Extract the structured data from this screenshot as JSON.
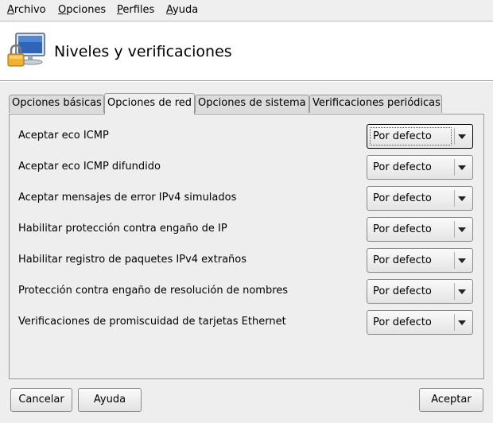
{
  "menubar": {
    "items": [
      {
        "accel": "A",
        "rest": "rchivo"
      },
      {
        "accel": "O",
        "rest": "pciones"
      },
      {
        "accel": "P",
        "rest": "erfiles"
      },
      {
        "accel": "A",
        "rest": "yuda"
      }
    ]
  },
  "header": {
    "title": "Niveles y verificaciones",
    "icon": "monitor-lock-icon"
  },
  "tabs": [
    {
      "label": "Opciones básicas",
      "active": false
    },
    {
      "label": "Opciones de red",
      "active": true
    },
    {
      "label": "Opciones de sistema",
      "active": false
    },
    {
      "label": "Verificaciones periódicas",
      "active": false
    }
  ],
  "options": [
    {
      "label": "Aceptar eco ICMP",
      "value": "Por defecto"
    },
    {
      "label": "Aceptar eco ICMP difundido",
      "value": "Por defecto"
    },
    {
      "label": "Aceptar mensajes de error IPv4 simulados",
      "value": "Por defecto"
    },
    {
      "label": "Habilitar protección contra engaño de IP",
      "value": "Por defecto"
    },
    {
      "label": "Habilitar registro de paquetes IPv4 extraños",
      "value": "Por defecto"
    },
    {
      "label": "Protección contra engaño de resolución de nombres",
      "value": "Por defecto"
    },
    {
      "label": "Verificaciones de promiscuidad de tarjetas Ethernet",
      "value": "Por defecto"
    }
  ],
  "buttons": {
    "cancel": "Cancelar",
    "help": "Ayuda",
    "accept": "Aceptar"
  }
}
